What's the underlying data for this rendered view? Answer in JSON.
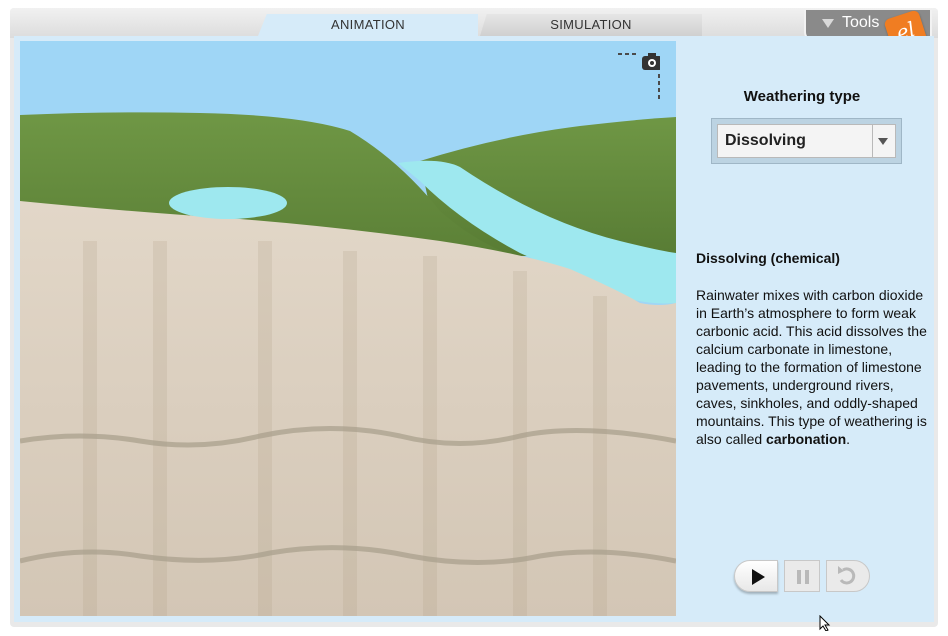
{
  "tabs": [
    {
      "label": "ANIMATION",
      "active": true
    },
    {
      "label": "SIMULATION",
      "active": false
    }
  ],
  "tools": {
    "label": "Tools",
    "logo_text": "el"
  },
  "scene": {
    "camera_icon": "camera-icon",
    "colors": {
      "sky": "#9fd6f6",
      "grass": "#6a8f3f",
      "water": "#9ee8ef",
      "rock": "#d9ccbb"
    }
  },
  "panel": {
    "weathering_label": "Weathering type",
    "dropdown_value": "Dissolving",
    "description_title": "Dissolving (chemical)",
    "description_text": "Rainwater mixes with carbon dioxide in Earth’s atmosphere to form weak carbonic acid. This acid dissolves the calcium carbonate in limestone, leading to the formation of limestone pavements, underground rivers, caves, sinkholes, and oddly-shaped mountains. This type of weathering is also called",
    "description_bold": "carbonation",
    "description_end": "."
  },
  "controls": {
    "play_icon": "play-icon",
    "pause_icon": "pause-icon",
    "reset_icon": "reset-icon"
  }
}
